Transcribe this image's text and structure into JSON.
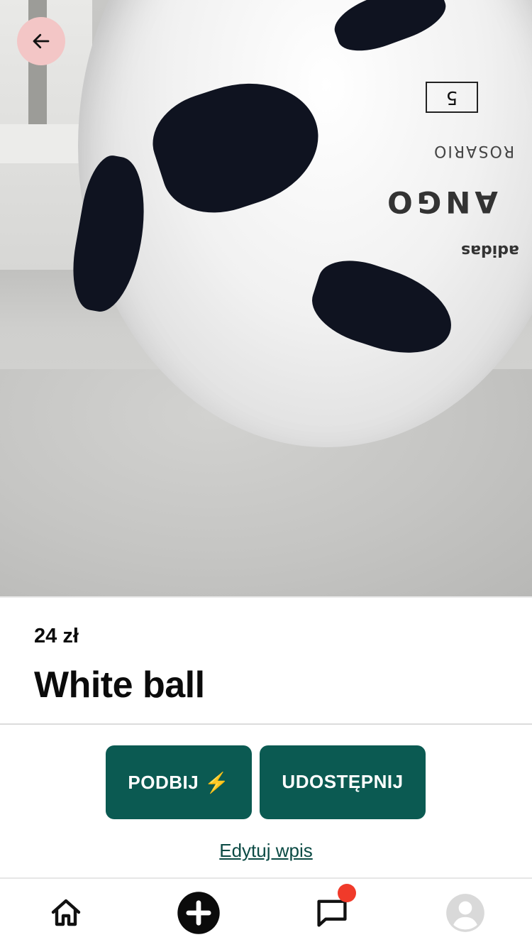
{
  "listing": {
    "price": "24 zł",
    "title": "White ball"
  },
  "photo": {
    "ball_number": "5",
    "ball_model": "ANGO",
    "ball_model_sub": "ROSARIO",
    "ball_brand": "adidas"
  },
  "actions": {
    "boost_label": "PODBIJ",
    "boost_icon": "⚡",
    "share_label": "UDOSTĘPNIJ",
    "edit_link": "Edytuj wpis"
  },
  "nav": {
    "home_icon": "home-icon",
    "add_icon": "plus-circle-icon",
    "messages_icon": "chat-icon",
    "profile_icon": "user-avatar-icon",
    "messages_badge": true
  },
  "colors": {
    "accent": "#0b5a52",
    "back_button_bg": "#f3c6c6",
    "badge": "#f03a2a",
    "link": "#0b4a44"
  }
}
